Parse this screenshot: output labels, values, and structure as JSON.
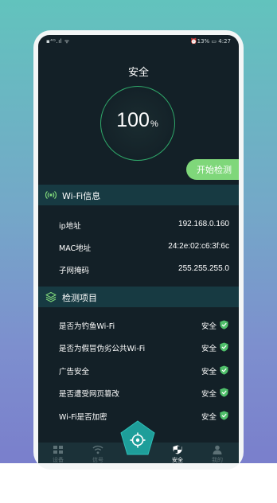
{
  "status_bar": {
    "left": "▪⁴ᴳ.ıl ᯤ",
    "right": "⏰13% ▭ 4:27"
  },
  "header": {
    "title": "安全"
  },
  "score": {
    "value": "100",
    "unit": "%"
  },
  "start_button": {
    "label": "开始检测"
  },
  "wifi_section": {
    "title": "Wi-Fi信息",
    "rows": [
      {
        "label": "ip地址",
        "value": "192.168.0.160"
      },
      {
        "label": "MAC地址",
        "value": "24:2e:02:c6:3f:6c"
      },
      {
        "label": "子网掩码",
        "value": "255.255.255.0"
      }
    ]
  },
  "check_section": {
    "title": "检测项目",
    "items": [
      {
        "label": "是否为钓鱼Wi-Fi",
        "status": "安全"
      },
      {
        "label": "是否为假冒伪劣公共Wi-Fi",
        "status": "安全"
      },
      {
        "label": "广告安全",
        "status": "安全"
      },
      {
        "label": "是否遭受网页篡改",
        "status": "安全"
      },
      {
        "label": "Wi-Fi是否加密",
        "status": "安全"
      }
    ]
  },
  "tab_bar": {
    "tabs": [
      {
        "label": "设备",
        "icon": "grid-icon"
      },
      {
        "label": "信号",
        "icon": "wifi-icon"
      },
      {
        "label": "检测",
        "icon": "scan-icon"
      },
      {
        "label": "安全",
        "icon": "shield-icon"
      },
      {
        "label": "我的",
        "icon": "person-icon"
      }
    ]
  },
  "colors": {
    "accent_green": "#7fd77a",
    "ring_green": "#2fa86a",
    "section_bg": "#173a42",
    "screen_bg": "#132027",
    "scan_button": "#1e9e9a"
  }
}
